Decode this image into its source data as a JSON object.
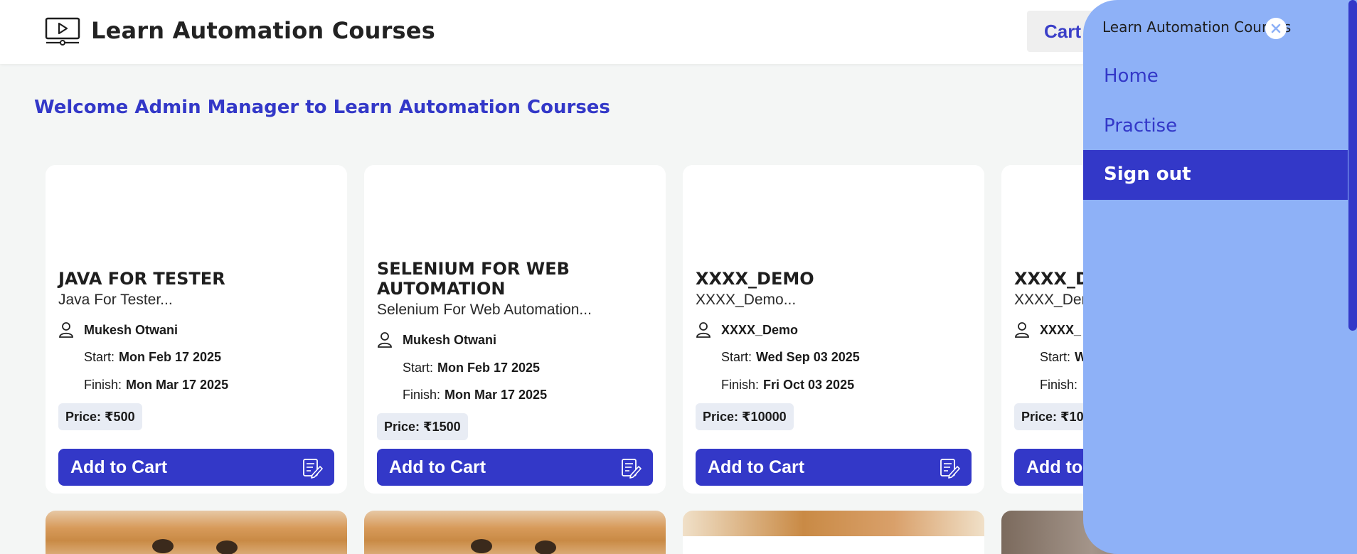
{
  "header": {
    "title": "Learn Automation Courses",
    "cart_label": "Cart"
  },
  "welcome": "Welcome Admin Manager to Learn Automation Courses",
  "courses": [
    {
      "title": "JAVA FOR TESTER",
      "subtitle": "Java For Tester...",
      "author": "Mukesh Otwani",
      "start_label": "Start:",
      "start": "Mon Feb 17 2025",
      "finish_label": "Finish:",
      "finish": "Mon Mar 17 2025",
      "price": "Price: ₹500",
      "button": "Add to Cart"
    },
    {
      "title": "SELENIUM FOR WEB AUTOMATION",
      "subtitle": "Selenium For Web Automation...",
      "author": "Mukesh Otwani",
      "start_label": "Start:",
      "start": "Mon Feb 17 2025",
      "finish_label": "Finish:",
      "finish": "Mon Mar 17 2025",
      "price": "Price: ₹1500",
      "button": "Add to Cart"
    },
    {
      "title": "XXXX_DEMO",
      "subtitle": "XXXX_Demo...",
      "author": "XXXX_Demo",
      "start_label": "Start:",
      "start": "Wed Sep 03 2025",
      "finish_label": "Finish:",
      "finish": "Fri Oct 03 2025",
      "price": "Price: ₹10000",
      "button": "Add to Cart"
    },
    {
      "title": "XXXX_D",
      "subtitle": "XXXX_Der",
      "author": "XXXX_",
      "start_label": "Start:",
      "start": "W",
      "finish_label": "Finish:",
      "finish": "",
      "price": "Price: ₹10(",
      "button": "Add to"
    }
  ],
  "drawer": {
    "title": "Learn Automation Courses",
    "items": [
      "Home",
      "Practise"
    ],
    "signout": "Sign out"
  },
  "icons": {
    "logo": "video-player-icon",
    "close": "close-icon",
    "author": "person-icon",
    "add_to_cart": "notepad-pencil-icon"
  },
  "colors": {
    "accent": "#3338c8",
    "drawer_bg": "#8eb1f7",
    "page_bg": "#f4f6f5"
  }
}
